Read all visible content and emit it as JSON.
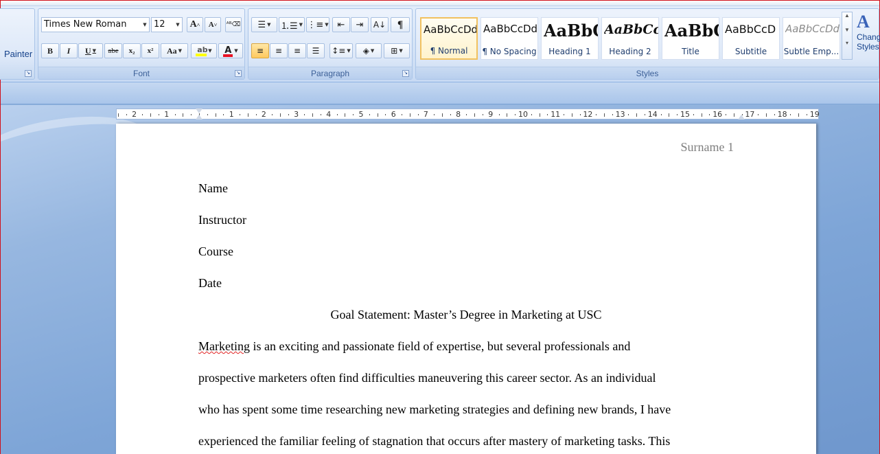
{
  "clipboard": {
    "painter_label": "Painter"
  },
  "font": {
    "group_label": "Font",
    "font_name": "Times New Roman",
    "font_size": "12",
    "grow_glyph": "A",
    "shrink_glyph": "A",
    "bold": "B",
    "italic": "I",
    "underline": "U",
    "strike": "abe",
    "subscript": "x₂",
    "superscript": "x²",
    "change_case": "Aa",
    "font_color_glyph": "A",
    "highlight_color": "#ffff00",
    "font_color": "#e81123"
  },
  "paragraph": {
    "group_label": "Paragraph",
    "show_marks_glyph": "¶"
  },
  "styles": {
    "group_label": "Styles",
    "change_styles_label_1": "Change",
    "change_styles_label_2": "Styles",
    "tiles": [
      {
        "sample": "AaBbCcDd",
        "name": "¶ Normal"
      },
      {
        "sample": "AaBbCcDd",
        "name": "¶ No Spacing"
      },
      {
        "sample": "AaBbC",
        "name": "Heading 1"
      },
      {
        "sample": "AaBbCc",
        "name": "Heading 2"
      },
      {
        "sample": "AaBbC",
        "name": "Title"
      },
      {
        "sample": "AaBbCcD",
        "name": "Subtitle"
      },
      {
        "sample": "AaBbCcDd",
        "name": "Subtle Emp..."
      }
    ]
  },
  "ruler": {
    "labels": [
      "2",
      "1",
      "1",
      "2",
      "3",
      "4",
      "5",
      "6",
      "7",
      "8",
      "9",
      "10",
      "11",
      "12",
      "13",
      "14",
      "15",
      "16",
      "17",
      "18",
      "19"
    ]
  },
  "document": {
    "header_surname": "Surname 1",
    "name": "Name",
    "instructor": "Instructor",
    "course": "Course",
    "date": "Date",
    "title": "Goal Statement: Master’s Degree in Marketing at USC",
    "line1_a": "Marketing",
    "line1_b": " is an exciting and passionate field of expertise, but several professionals and",
    "line2": "prospective marketers often find difficulties maneuvering this career sector. As an individual",
    "line3": "who has spent some time researching new marketing strategies and defining new brands, I have",
    "line4": "experienced the familiar feeling of stagnation that occurs after mastery of marketing tasks. This"
  }
}
